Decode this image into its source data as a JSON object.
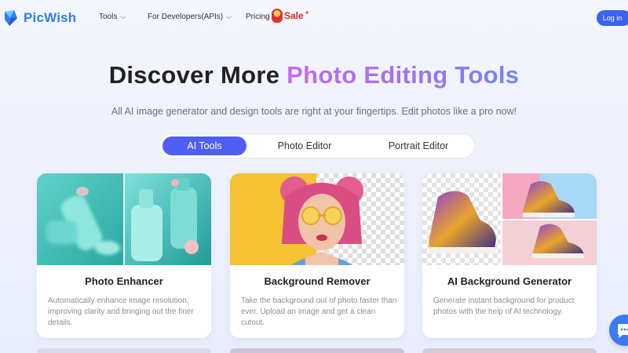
{
  "header": {
    "logo_text": "PicWish",
    "nav": [
      {
        "label": "Tools"
      },
      {
        "label": "For Developers(APIs)"
      },
      {
        "label": "Pricing"
      }
    ],
    "sale_label": "Sale",
    "login_label": "Log in"
  },
  "hero": {
    "title_plain": "Discover More ",
    "title_highlight": "Photo Editing Tools",
    "subtitle": "All AI image generator and design tools are right at your fingertips. Edit photos like a pro now!"
  },
  "tabs": [
    {
      "label": "AI Tools",
      "active": true
    },
    {
      "label": "Photo Editor",
      "active": false
    },
    {
      "label": "Portrait Editor",
      "active": false
    }
  ],
  "cards": [
    {
      "title": "Photo Enhancer",
      "description": "Automatically enhance image resolution, improving clarity and bringing out the finer details."
    },
    {
      "title": "Background Remover",
      "description": "Take the background out of photo faster than ever. Upload an image and get a clean cutout."
    },
    {
      "title": "AI Background Generator",
      "description": "Generate instant background for product photos with the help of AI technology."
    }
  ],
  "colors": {
    "brand_blue": "#2e7cf6",
    "active_tab": "#4f5ef3",
    "login_button": "#3b62f0",
    "sale_red": "#d92a1f"
  }
}
